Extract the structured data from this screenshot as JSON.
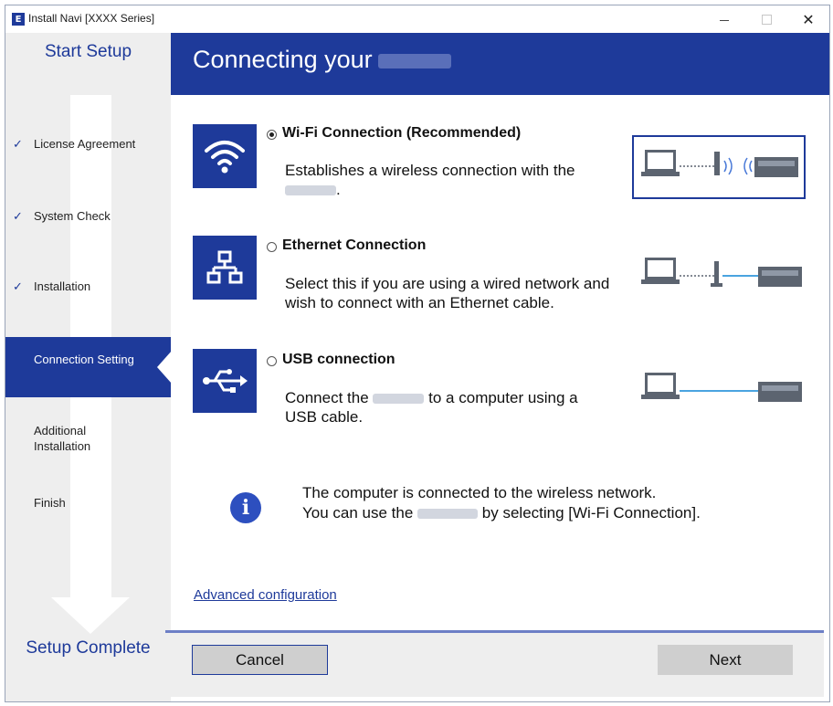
{
  "window": {
    "title": "Install Navi [XXXX Series]",
    "icon_letter": "E",
    "controls": {
      "minimize": "minimize",
      "maximize": "maximize",
      "close": "✕"
    }
  },
  "sidebar": {
    "top_label": "Start Setup",
    "bottom_label": "Setup Complete",
    "steps": [
      {
        "label": "License Agreement",
        "done": true
      },
      {
        "label": "System Check",
        "done": true
      },
      {
        "label": "Installation",
        "done": true
      },
      {
        "label": "Connection Setting",
        "active": true
      },
      {
        "label": "Additional\nInstallation"
      },
      {
        "label": "Finish"
      }
    ]
  },
  "header": {
    "title": "Connecting your"
  },
  "options": [
    {
      "title": "Wi-Fi Connection (Recommended)",
      "selected": true,
      "desc_line1": "Establishes a wireless connection with the",
      "desc_line2_end": ".",
      "icon": "wifi-icon"
    },
    {
      "title": "Ethernet Connection",
      "selected": false,
      "desc": "Select this if you are using a wired network and wish to connect with an Ethernet cable.",
      "icon": "network-icon"
    },
    {
      "title": "USB connection",
      "selected": false,
      "desc_start": "Connect the",
      "desc_end": "to a computer using a USB cable.",
      "icon": "usb-icon"
    }
  ],
  "info": {
    "line1": "The computer is connected to the wireless network.",
    "line2_start": "You can use the",
    "line2_end": "by selecting [Wi-Fi Connection].",
    "icon_glyph": "i"
  },
  "advanced_link": "Advanced configuration",
  "buttons": {
    "cancel": "Cancel",
    "next": "Next"
  },
  "colors": {
    "brand": "#1e3a9a",
    "sidebar_bg": "#eeeeee",
    "button_bg": "#cfcfcf"
  }
}
